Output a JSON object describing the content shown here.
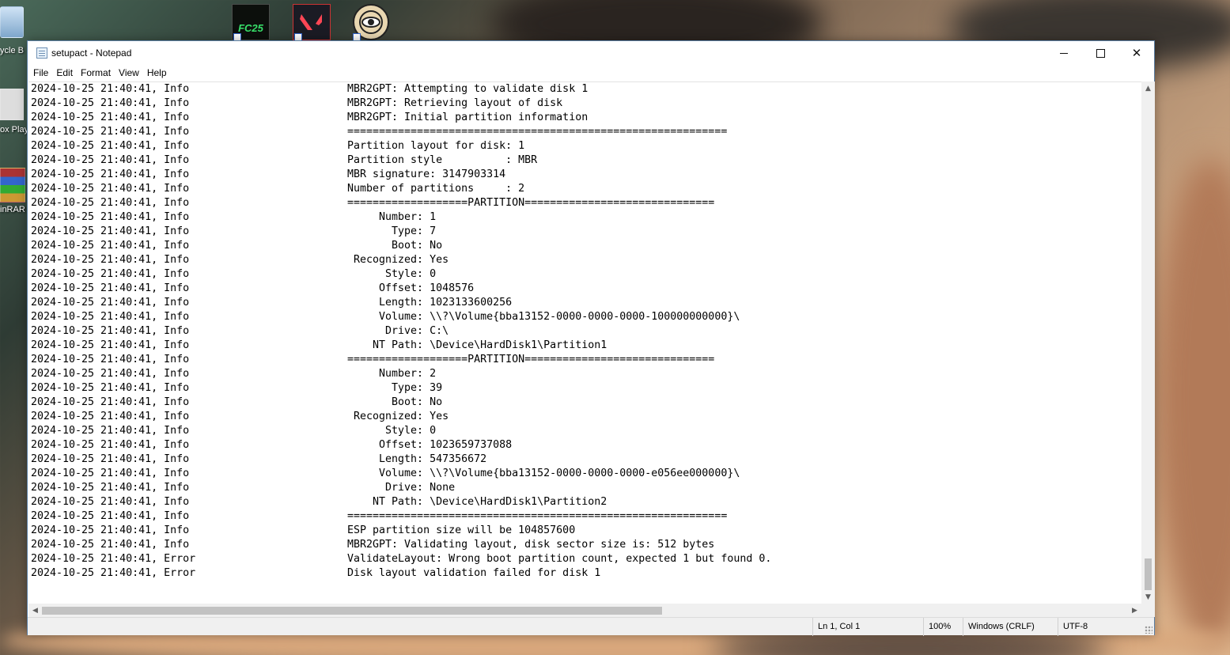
{
  "desktop": {
    "icons": [
      {
        "name": "recycle-bin",
        "label": "ycle B"
      },
      {
        "name": "roblox-player",
        "label": "ox Play"
      },
      {
        "name": "winrar",
        "label": "inRAR"
      },
      {
        "name": "fc25",
        "label": "FC25"
      },
      {
        "name": "valorant",
        "label": ""
      },
      {
        "name": "eye-app",
        "label": ""
      }
    ]
  },
  "window": {
    "title": "setupact - Notepad",
    "controls": {
      "minimize": "",
      "maximize": "",
      "close": "✕"
    }
  },
  "menu": [
    "File",
    "Edit",
    "Format",
    "View",
    "Help"
  ],
  "lines": [
    {
      "ts": "2024-10-25 21:40:41, Info",
      "msg": "MBR2GPT: Attempting to validate disk 1"
    },
    {
      "ts": "2024-10-25 21:40:41, Info",
      "msg": "MBR2GPT: Retrieving layout of disk"
    },
    {
      "ts": "2024-10-25 21:40:41, Info",
      "msg": "MBR2GPT: Initial partition information"
    },
    {
      "ts": "2024-10-25 21:40:41, Info",
      "msg": "============================================================"
    },
    {
      "ts": "2024-10-25 21:40:41, Info",
      "msg": "Partition layout for disk: 1"
    },
    {
      "ts": "2024-10-25 21:40:41, Info",
      "msg": "Partition style          : MBR"
    },
    {
      "ts": "2024-10-25 21:40:41, Info",
      "msg": "MBR signature: 3147903314"
    },
    {
      "ts": "2024-10-25 21:40:41, Info",
      "msg": "Number of partitions     : 2"
    },
    {
      "ts": "2024-10-25 21:40:41, Info",
      "msg": "===================PARTITION=============================="
    },
    {
      "ts": "2024-10-25 21:40:41, Info",
      "msg": "     Number: 1"
    },
    {
      "ts": "2024-10-25 21:40:41, Info",
      "msg": "       Type: 7"
    },
    {
      "ts": "2024-10-25 21:40:41, Info",
      "msg": "       Boot: No"
    },
    {
      "ts": "2024-10-25 21:40:41, Info",
      "msg": " Recognized: Yes"
    },
    {
      "ts": "2024-10-25 21:40:41, Info",
      "msg": "      Style: 0"
    },
    {
      "ts": "2024-10-25 21:40:41, Info",
      "msg": "     Offset: 1048576"
    },
    {
      "ts": "2024-10-25 21:40:41, Info",
      "msg": "     Length: 1023133600256"
    },
    {
      "ts": "2024-10-25 21:40:41, Info",
      "msg": "     Volume: \\\\?\\Volume{bba13152-0000-0000-0000-100000000000}\\"
    },
    {
      "ts": "2024-10-25 21:40:41, Info",
      "msg": "      Drive: C:\\"
    },
    {
      "ts": "2024-10-25 21:40:41, Info",
      "msg": "    NT Path: \\Device\\HardDisk1\\Partition1"
    },
    {
      "ts": "2024-10-25 21:40:41, Info",
      "msg": "===================PARTITION=============================="
    },
    {
      "ts": "2024-10-25 21:40:41, Info",
      "msg": "     Number: 2"
    },
    {
      "ts": "2024-10-25 21:40:41, Info",
      "msg": "       Type: 39"
    },
    {
      "ts": "2024-10-25 21:40:41, Info",
      "msg": "       Boot: No"
    },
    {
      "ts": "2024-10-25 21:40:41, Info",
      "msg": " Recognized: Yes"
    },
    {
      "ts": "2024-10-25 21:40:41, Info",
      "msg": "      Style: 0"
    },
    {
      "ts": "2024-10-25 21:40:41, Info",
      "msg": "     Offset: 1023659737088"
    },
    {
      "ts": "2024-10-25 21:40:41, Info",
      "msg": "     Length: 547356672"
    },
    {
      "ts": "2024-10-25 21:40:41, Info",
      "msg": "     Volume: \\\\?\\Volume{bba13152-0000-0000-0000-e056ee000000}\\"
    },
    {
      "ts": "2024-10-25 21:40:41, Info",
      "msg": "      Drive: None"
    },
    {
      "ts": "2024-10-25 21:40:41, Info",
      "msg": "    NT Path: \\Device\\HardDisk1\\Partition2"
    },
    {
      "ts": "2024-10-25 21:40:41, Info",
      "msg": "============================================================"
    },
    {
      "ts": "2024-10-25 21:40:41, Info",
      "msg": "ESP partition size will be 104857600"
    },
    {
      "ts": "2024-10-25 21:40:41, Info",
      "msg": "MBR2GPT: Validating layout, disk sector size is: 512 bytes"
    },
    {
      "ts": "2024-10-25 21:40:41, Error",
      "msg": "ValidateLayout: Wrong boot partition count, expected 1 but found 0."
    },
    {
      "ts": "2024-10-25 21:40:41, Error",
      "msg": "Disk layout validation failed for disk 1"
    }
  ],
  "status": {
    "position": "Ln 1, Col 1",
    "zoom": "100%",
    "line_endings": "Windows (CRLF)",
    "encoding": "UTF-8"
  }
}
